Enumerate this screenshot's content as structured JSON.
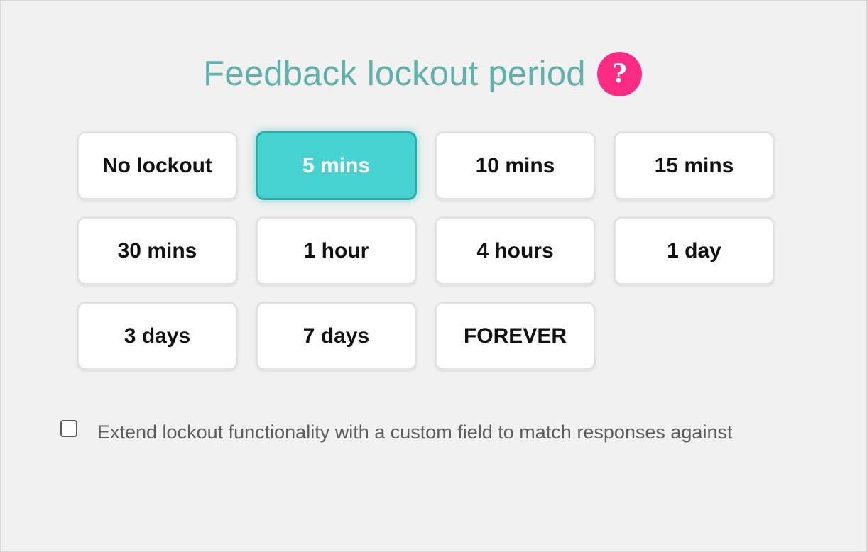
{
  "title": "Feedback lockout period",
  "help_icon": {
    "glyph": "?",
    "color": "#fc2c84"
  },
  "accent_color": "#47d2d2",
  "title_color": "#5fb1ab",
  "options": [
    {
      "label": "No lockout",
      "selected": false
    },
    {
      "label": "5 mins",
      "selected": true
    },
    {
      "label": "10 mins",
      "selected": false
    },
    {
      "label": "15 mins",
      "selected": false
    },
    {
      "label": "30 mins",
      "selected": false
    },
    {
      "label": "1 hour",
      "selected": false
    },
    {
      "label": "4 hours",
      "selected": false
    },
    {
      "label": "1 day",
      "selected": false
    },
    {
      "label": "3 days",
      "selected": false
    },
    {
      "label": "7 days",
      "selected": false
    },
    {
      "label": "FOREVER",
      "selected": false
    }
  ],
  "extend_lockout": {
    "checked": false,
    "label": "Extend lockout functionality with a custom field to match responses against"
  }
}
